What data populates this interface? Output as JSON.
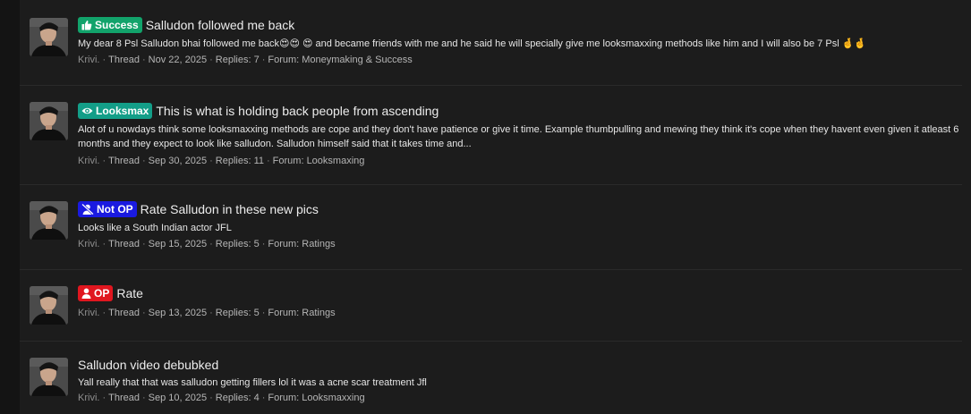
{
  "threads": [
    {
      "title": "Salludon followed me back",
      "badge": {
        "label": "Success",
        "color": "#12a36b",
        "icon": "thumbs-up-icon"
      },
      "snippet": "My dear 8 Psl Salludon bhai followed me back😍😍 😍  and became friends with me and he said he will specially give me looksmaxxing methods like him and I will also be 7 Psl 🤞🤞",
      "author": "Krivi.",
      "type": "Thread",
      "date": "Nov 22, 2025",
      "replies": "Replies: 7",
      "forum": "Forum: Moneymaking & Success"
    },
    {
      "title": "This is what is holding back people from ascending",
      "badge": {
        "label": "Looksmax",
        "color": "#139e88",
        "icon": "eye-icon"
      },
      "snippet": "Alot of u nowdays think some looksmaxxing methods are cope and they don't have patience or give it time. Example thumbpulling and mewing they think it's cope when they havent even given it atleast 6 months and they expect to look like salludon. Salludon himself said that it takes time and...",
      "author": "Krivi.",
      "type": "Thread",
      "date": "Sep 30, 2025",
      "replies": "Replies: 11",
      "forum": "Forum: Looksmaxing"
    },
    {
      "title": "Rate Salludon in these new pics",
      "badge": {
        "label": "Not OP",
        "color": "#1a1ae0",
        "icon": "user-slash-icon"
      },
      "snippet": "Looks like a South Indian actor JFL",
      "author": "Krivi.",
      "type": "Thread",
      "date": "Sep 15, 2025",
      "replies": "Replies: 5",
      "forum": "Forum: Ratings"
    },
    {
      "title": "Rate",
      "badge": {
        "label": "OP",
        "color": "#e0161f",
        "icon": "user-icon"
      },
      "snippet": "",
      "author": "Krivi.",
      "type": "Thread",
      "date": "Sep 13, 2025",
      "replies": "Replies: 5",
      "forum": "Forum: Ratings"
    },
    {
      "title": "Salludon video debubked",
      "badge": null,
      "snippet": "Yall really that that was salludon getting fillers lol it was a acne scar treatment Jfl",
      "author": "Krivi.",
      "type": "Thread",
      "date": "Sep 10, 2025",
      "replies": "Replies: 4",
      "forum": "Forum: Looksmaxxing"
    }
  ]
}
